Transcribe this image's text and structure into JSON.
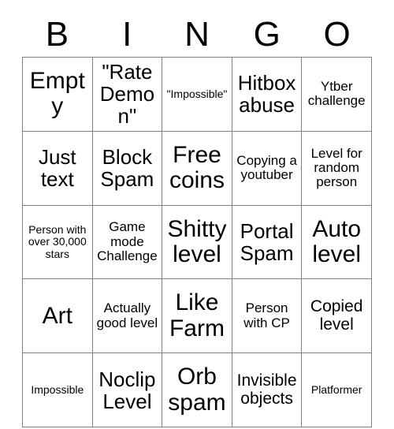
{
  "card": {
    "header": {
      "letters": [
        "B",
        "I",
        "N",
        "G",
        "O"
      ]
    },
    "grid": {
      "rows": 5,
      "columns": 5,
      "cells": [
        [
          {
            "text": "Empty",
            "size": "fs-xl"
          },
          {
            "text": "\"Rate Demon\"",
            "size": "fs-lg"
          },
          {
            "text": "\"Impossible\"",
            "size": "fs-xs"
          },
          {
            "text": "Hitbox abuse",
            "size": "fs-lg"
          },
          {
            "text": "Ytber challenge",
            "size": "fs-sm"
          }
        ],
        [
          {
            "text": "Just text",
            "size": "fs-lg"
          },
          {
            "text": "Block Spam",
            "size": "fs-lg"
          },
          {
            "text": "Free coins",
            "size": "fs-xl"
          },
          {
            "text": "Copying a youtuber",
            "size": "fs-sm"
          },
          {
            "text": "Level for random person",
            "size": "fs-sm"
          }
        ],
        [
          {
            "text": "Person with over 30,000 stars",
            "size": "fs-xs"
          },
          {
            "text": "Game mode Challenge",
            "size": "fs-sm"
          },
          {
            "text": "Shitty level",
            "size": "fs-xl"
          },
          {
            "text": "Portal Spam",
            "size": "fs-lg"
          },
          {
            "text": "Auto level",
            "size": "fs-xl"
          }
        ],
        [
          {
            "text": "Art",
            "size": "fs-xl"
          },
          {
            "text": "Actually good level",
            "size": "fs-sm"
          },
          {
            "text": "Like Farm",
            "size": "fs-xl"
          },
          {
            "text": "Person with CP",
            "size": "fs-sm"
          },
          {
            "text": "Copied level",
            "size": "fs-md"
          }
        ],
        [
          {
            "text": "Impossible",
            "size": "fs-xs"
          },
          {
            "text": "Noclip Level",
            "size": "fs-lg"
          },
          {
            "text": "Orb spam",
            "size": "fs-xl"
          },
          {
            "text": "Invisible objects",
            "size": "fs-md"
          },
          {
            "text": "Platformer",
            "size": "fs-xs"
          }
        ]
      ]
    },
    "colors": {
      "background": "#ffffff",
      "text": "#000000",
      "grid_line": "#808080"
    }
  }
}
